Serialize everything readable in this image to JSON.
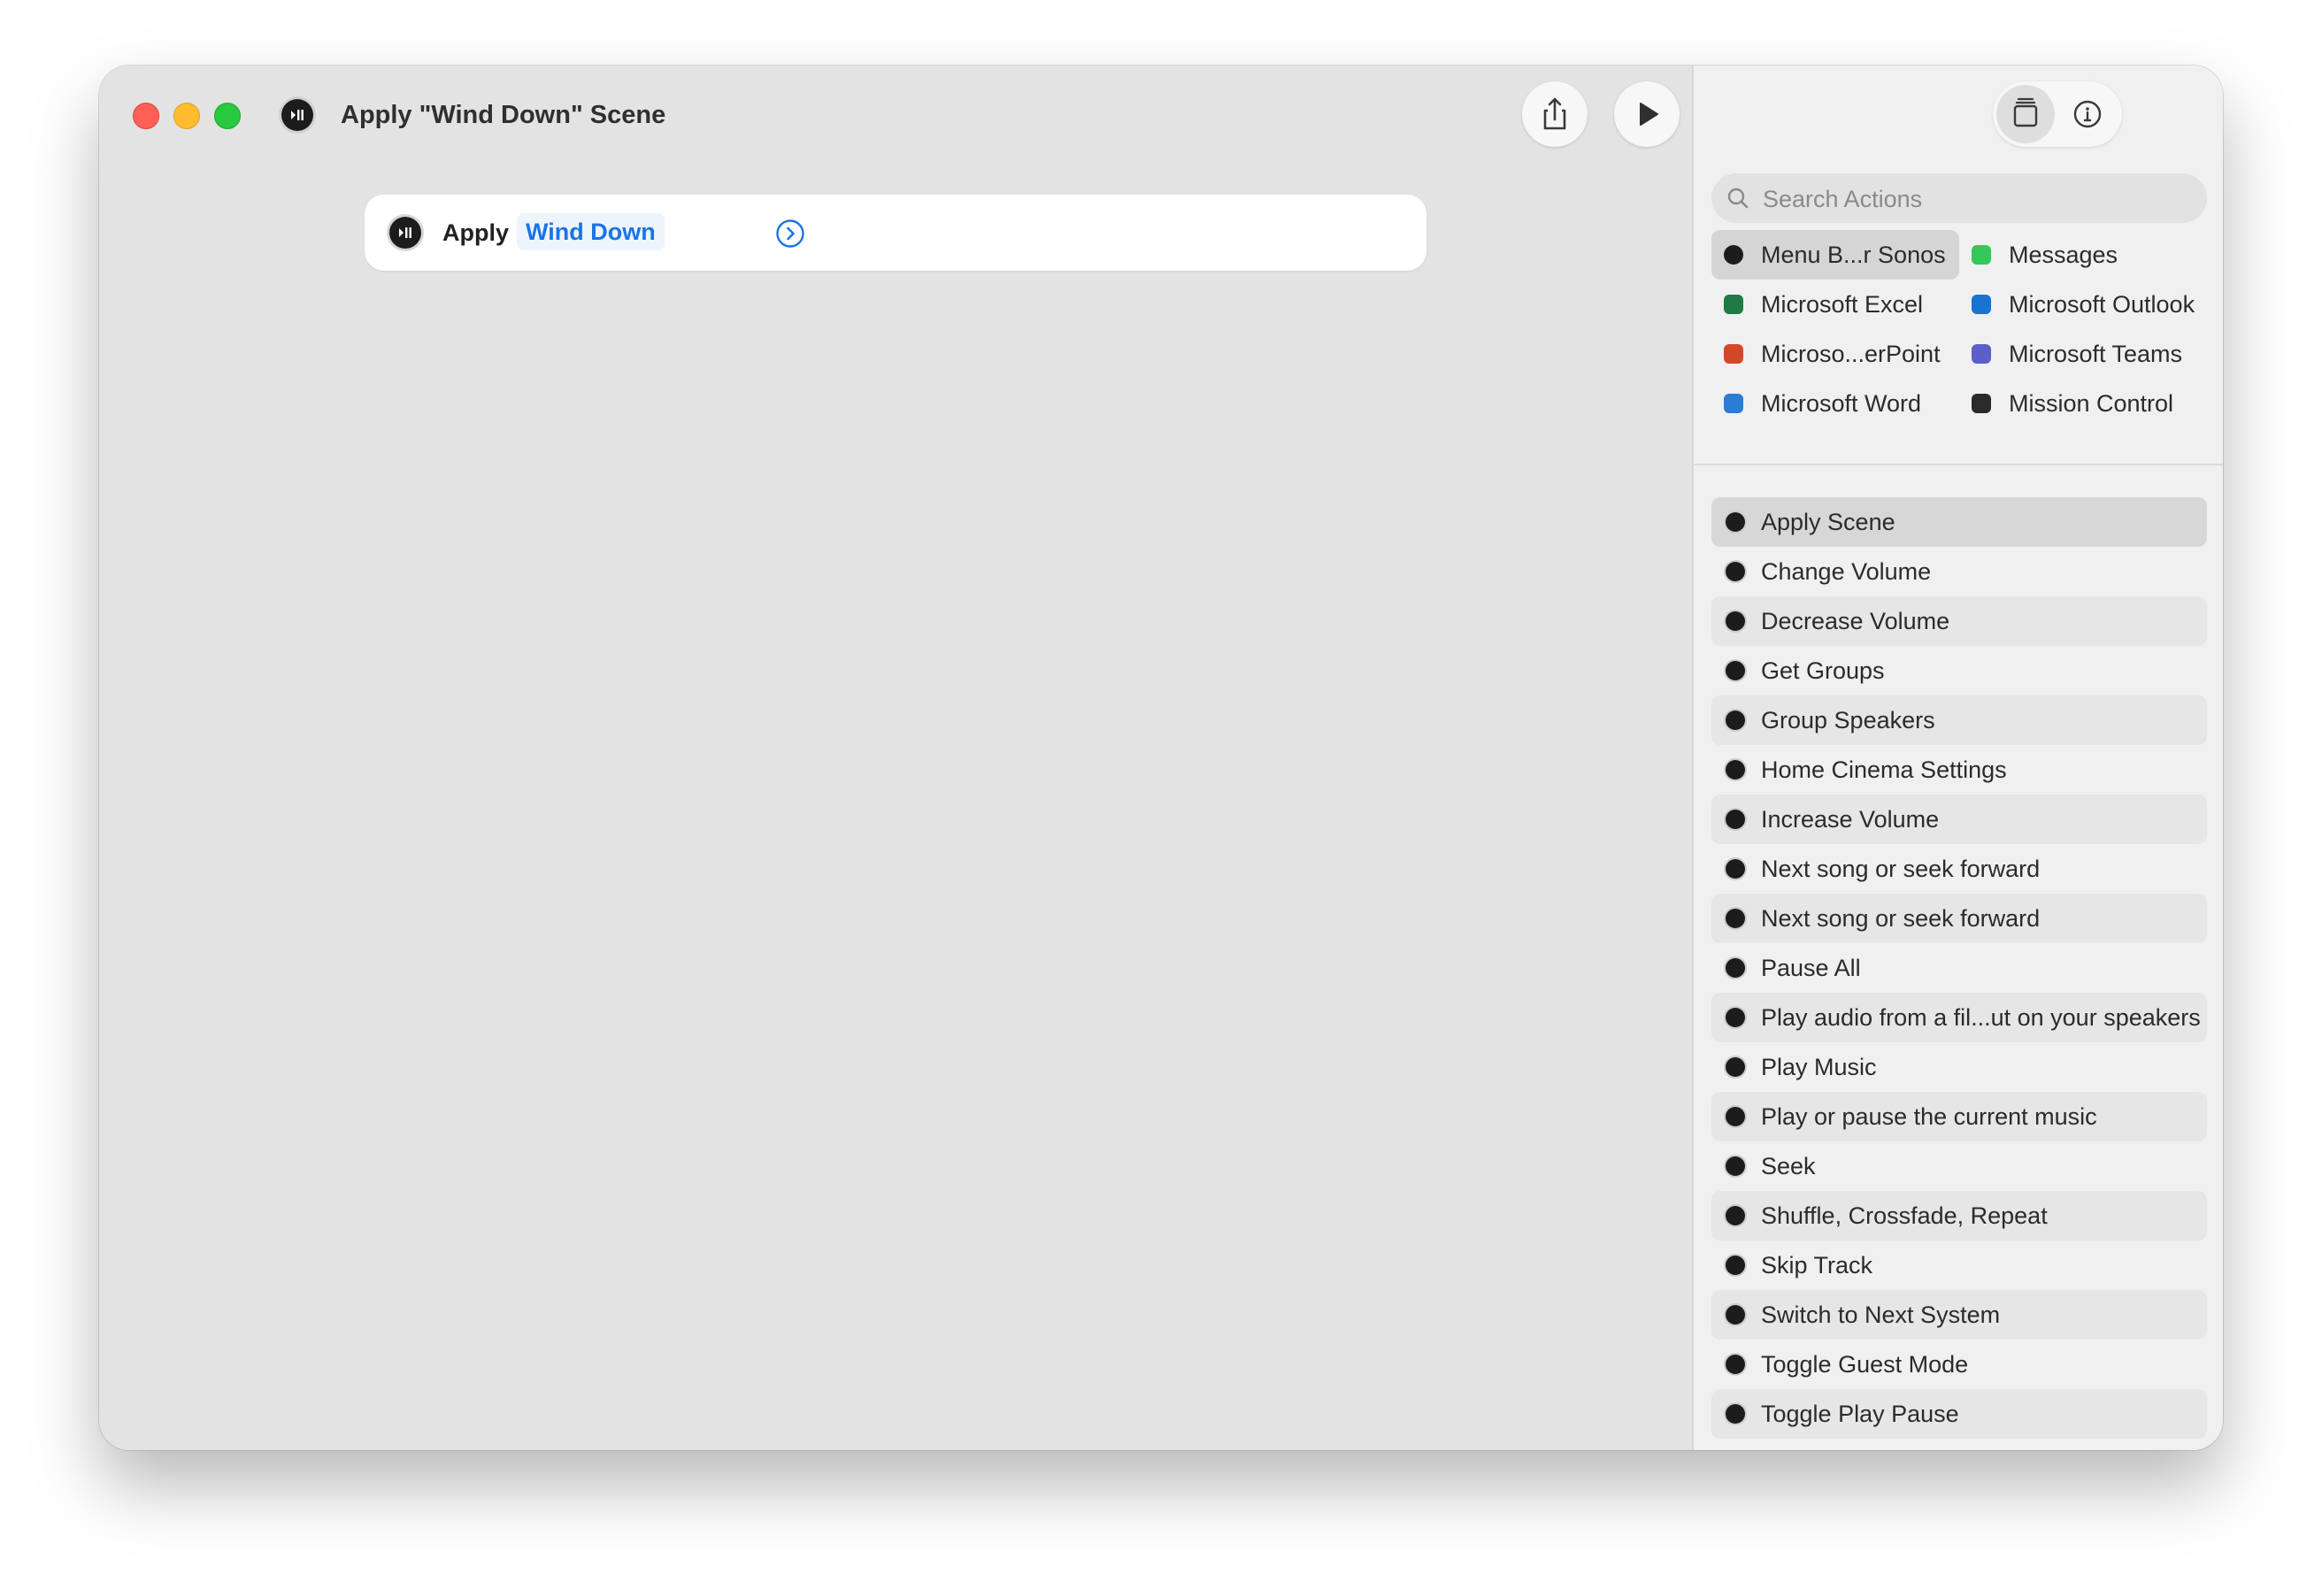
{
  "window": {
    "title": "Apply \"Wind Down\" Scene",
    "app_icon": "sonos-icon"
  },
  "toolbar": {
    "share_icon": "share-icon",
    "run_icon": "play-icon"
  },
  "editor": {
    "action": {
      "verb": "Apply",
      "parameter": "Wind Down",
      "parameter_color": "#1a73e8",
      "icon": "sonos-icon",
      "chevron_icon": "chevron-right-circle-icon"
    }
  },
  "sidebar": {
    "segment": {
      "library_icon": "library-icon",
      "info_icon": "info-icon"
    },
    "search": {
      "placeholder": "Search Actions",
      "value": ""
    },
    "apps": [
      {
        "label": "Menu B...r Sonos",
        "icon": "sonos-icon",
        "color": "#1c1c1c",
        "selected": true
      },
      {
        "label": "Messages",
        "icon": "messages-icon",
        "color": "#34c759"
      },
      {
        "label": "Microsoft Excel",
        "icon": "excel-icon",
        "color": "#1f7a45"
      },
      {
        "label": "Microsoft Outlook",
        "icon": "outlook-icon",
        "color": "#1a73d1"
      },
      {
        "label": "Microso...erPoint",
        "icon": "powerpoint-icon",
        "color": "#d24726"
      },
      {
        "label": "Microsoft Teams",
        "icon": "teams-icon",
        "color": "#5b5fc7"
      },
      {
        "label": "Microsoft Word",
        "icon": "word-icon",
        "color": "#2b7cd3"
      },
      {
        "label": "Mission Control",
        "icon": "mission-control-icon",
        "color": "#2a2a2a"
      }
    ],
    "actions": [
      {
        "label": "Apply Scene",
        "selected": true
      },
      {
        "label": "Change Volume"
      },
      {
        "label": "Decrease Volume"
      },
      {
        "label": "Get Groups"
      },
      {
        "label": "Group Speakers"
      },
      {
        "label": "Home Cinema Settings"
      },
      {
        "label": "Increase Volume"
      },
      {
        "label": "Next song or seek forward"
      },
      {
        "label": "Next song or seek forward"
      },
      {
        "label": "Pause All"
      },
      {
        "label": "Play audio from a fil...ut on your speakers"
      },
      {
        "label": "Play Music"
      },
      {
        "label": "Play or pause the current music"
      },
      {
        "label": "Seek"
      },
      {
        "label": "Shuffle, Crossfade, Repeat"
      },
      {
        "label": "Skip Track"
      },
      {
        "label": "Switch to Next System"
      },
      {
        "label": "Toggle Guest Mode"
      },
      {
        "label": "Toggle Play Pause"
      }
    ]
  }
}
